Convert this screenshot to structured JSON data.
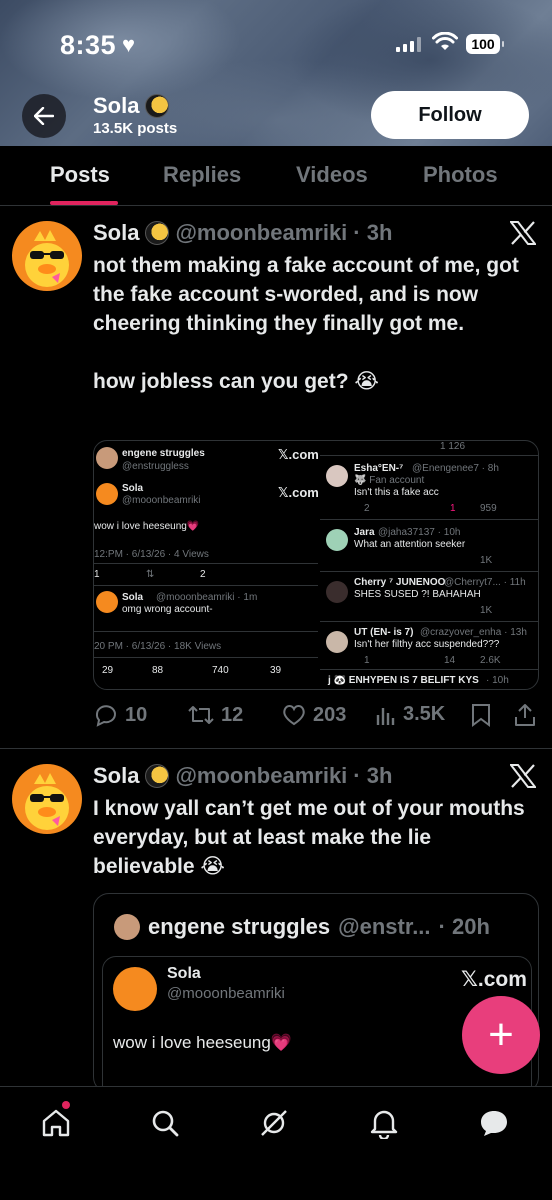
{
  "status_bar": {
    "time": "8:35",
    "battery": "100"
  },
  "profile": {
    "name": "Sola",
    "posts_count": "13.5K posts",
    "follow_label": "Follow"
  },
  "tabs": [
    {
      "label": "Posts",
      "active": true
    },
    {
      "label": "Replies",
      "active": false
    },
    {
      "label": "Videos",
      "active": false
    },
    {
      "label": "Photos",
      "active": false
    }
  ],
  "post1": {
    "name": "Sola",
    "handle": "@moonbeamriki",
    "time": "· 3h",
    "text": "not them making a fake account of me, got the fake account s-worded, and is now cheering thinking they finally got me.\n\nhow jobless can you get? 😭",
    "media": {
      "left": {
        "top_name": "engene struggles",
        "top_handle": "@enstruggless",
        "xcom": "𝕏.com",
        "quoted_name": "Sola",
        "quoted_handle": "@mooonbeamriki",
        "quoted_text": "wow i love heeseung💗",
        "quoted_meta": "12:PM · 6/13/26 · 4 Views",
        "q_reply": "1",
        "q_like": "2",
        "reply_name": "Sola",
        "reply_handle": "@mooonbeamriki · 1m",
        "reply_text": "omg wrong account-",
        "meta2": "20 PM · 6/13/26 · 18K Views",
        "replies": "29",
        "reposts": "88",
        "likes": "740",
        "bookmarks": "39"
      },
      "right": {
        "top_counts": "1   126",
        "c1_name": "Esha°EN-⁷",
        "c1_handle": "@Enengenee7 · 8h",
        "c1_badge": "🐺 Fan account",
        "c1_text": "Isn't this a fake acc",
        "c1_reply": "2",
        "c1_like": "1",
        "c1_views": "959",
        "c2_name": "Jara",
        "c2_handle": "@jaha37137 · 10h",
        "c2_text": "What an attention seeker",
        "c2_views": "1K",
        "c3_name": "Cherry ⁷ JUNENOO",
        "c3_handle": "@Cherryt7... · 11h",
        "c3_text": "SHES SUSED ?! BAHAHAH",
        "c3_views": "1K",
        "c4_name": "UT (EN- is 7)",
        "c4_handle": "@crazyover_enha · 13h",
        "c4_text": "Isn't her filthy acc suspended???",
        "c4_reply": "1",
        "c4_like": "14",
        "c4_views": "2.6K",
        "c5_name": "j 🐼 ENHYPEN IS 7 BELIFT KYS",
        "c5_handle": "· 10h"
      }
    },
    "replies": "10",
    "reposts": "12",
    "likes": "203",
    "views": "3.5K"
  },
  "post2": {
    "name": "Sola",
    "handle": "@moonbeamriki",
    "time": "· 3h",
    "text": "I know yall can’t get me out of your mouths everyday, but at least make the lie believable 😭",
    "quote": {
      "name": "engene struggles",
      "handle": "@enstr...",
      "time": "· 20h",
      "inner_name": "Sola",
      "inner_handle": "@mooonbeamriki",
      "inner_xcom": "𝕏.com",
      "inner_text": "wow i love heeseung💗"
    }
  },
  "fab_label": "+",
  "colors": {
    "accent": "#e0245e",
    "fab": "#e83e7c",
    "avatar_bg": "#f58a1f"
  }
}
